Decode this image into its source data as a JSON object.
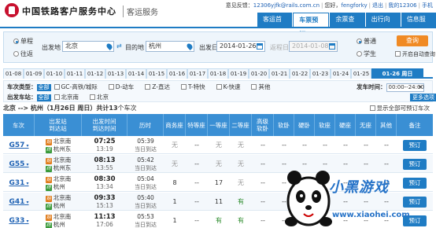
{
  "header": {
    "brand": "中国铁路客户服务中心",
    "brand_sub": "客运服务",
    "feedback_label": "意见反馈：",
    "feedback_email": "12306yjfk@rails.com.cn",
    "welcome": "您好，",
    "user": "fengforky",
    "logout": "退出",
    "my_account": "我的12306",
    "mobile": "手机",
    "nav": [
      "客运首页",
      "车票预订",
      "余票查询",
      "出行向导",
      "信息服务"
    ]
  },
  "search": {
    "trip_one_way": "单程",
    "trip_round": "往返",
    "from_label": "出发地",
    "from_value": "北京",
    "to_label": "目的地",
    "to_value": "杭州",
    "depart_date_label": "出发日",
    "depart_date": "2014-01-26",
    "return_date_label": "返程日",
    "return_date": "2014-01-08",
    "type_normal": "普通",
    "type_student": "学生",
    "query_button": "查询",
    "auto_query": "开启自动查询"
  },
  "dates": [
    "01-08",
    "01-09",
    "01-10",
    "01-11",
    "01-12",
    "01-13",
    "01-14",
    "01-15",
    "01-16",
    "01-17",
    "01-18",
    "01-19",
    "01-20",
    "01-21",
    "01-22",
    "01-23",
    "01-24",
    "01-25",
    "01-26 周日"
  ],
  "filters": {
    "train_type_label": "车次类型：",
    "all_label": "全部",
    "train_types": [
      "GC-高铁/城际",
      "D-动车",
      "Z-直达",
      "T-特快",
      "K-快速",
      "其他"
    ],
    "depart_time_label": "发车时间：",
    "depart_time_value": "00:00--24:00",
    "station_label": "出发车站：",
    "stations": [
      "北京南",
      "北京"
    ],
    "more_options": "更多选项"
  },
  "summary": {
    "route": "北京 --> 杭州（1月26日 周日）共计",
    "count": "13",
    "suffix": "个车次",
    "show_all": "显示全部可预订车次"
  },
  "table": {
    "headers": [
      "车次",
      "出发站\n到达站",
      "出发时间\n到达时间",
      "历时",
      "商务座",
      "特等座",
      "一等座",
      "二等座",
      "高级\n软卧",
      "软卧",
      "硬卧",
      "软座",
      "硬座",
      "无座",
      "其他",
      "备注"
    ],
    "rows": [
      {
        "train": "G57",
        "from": "北京南",
        "to": "杭州东",
        "dep": "07:25",
        "arr": "13:19",
        "dur": "05:39",
        "dur_note": "当日到达",
        "seats": [
          "无",
          "--",
          "无",
          "无",
          "--",
          "--",
          "--",
          "--",
          "--",
          "--",
          "--"
        ],
        "book": "预订"
      },
      {
        "train": "G55",
        "from": "北京南",
        "to": "杭州东",
        "dep": "08:13",
        "arr": "13:55",
        "dur": "05:42",
        "dur_note": "当日到达",
        "seats": [
          "无",
          "--",
          "无",
          "无",
          "--",
          "--",
          "--",
          "--",
          "--",
          "--",
          "--"
        ],
        "book": "预订"
      },
      {
        "train": "G31",
        "from": "北京南",
        "to": "杭州",
        "dep": "08:30",
        "arr": "13:34",
        "dur": "05:04",
        "dur_note": "当日到达",
        "seats": [
          "8",
          "--",
          "17",
          "无",
          "--",
          "--",
          "--",
          "--",
          "--",
          "--",
          "--"
        ],
        "book": "预订"
      },
      {
        "train": "G41",
        "from": "北京南",
        "to": "杭州",
        "dep": "09:33",
        "arr": "15:13",
        "dur": "05:40",
        "dur_note": "当日到达",
        "seats": [
          "1",
          "--",
          "11",
          "有",
          "--",
          "--",
          "--",
          "--",
          "--",
          "--",
          "--"
        ],
        "book": "预订"
      },
      {
        "train": "G33",
        "from": "北京南",
        "to": "杭州",
        "dep": "11:13",
        "arr": "17:06",
        "dur": "05:53",
        "dur_note": "当日到达",
        "seats": [
          "1",
          "--",
          "有",
          "有",
          "--",
          "--",
          "--",
          "--",
          "--",
          "--",
          "--"
        ],
        "book": "预订"
      }
    ]
  },
  "watermark": {
    "text": "小黑游戏",
    "url": "www.xiaohei.com"
  },
  "colors": {
    "brand_blue": "#1f7cc4",
    "header_blue": "#3a8fd4",
    "query_orange": "#f08a24",
    "logo_red": "#c8102e",
    "available_green": "#2a8a2a"
  }
}
